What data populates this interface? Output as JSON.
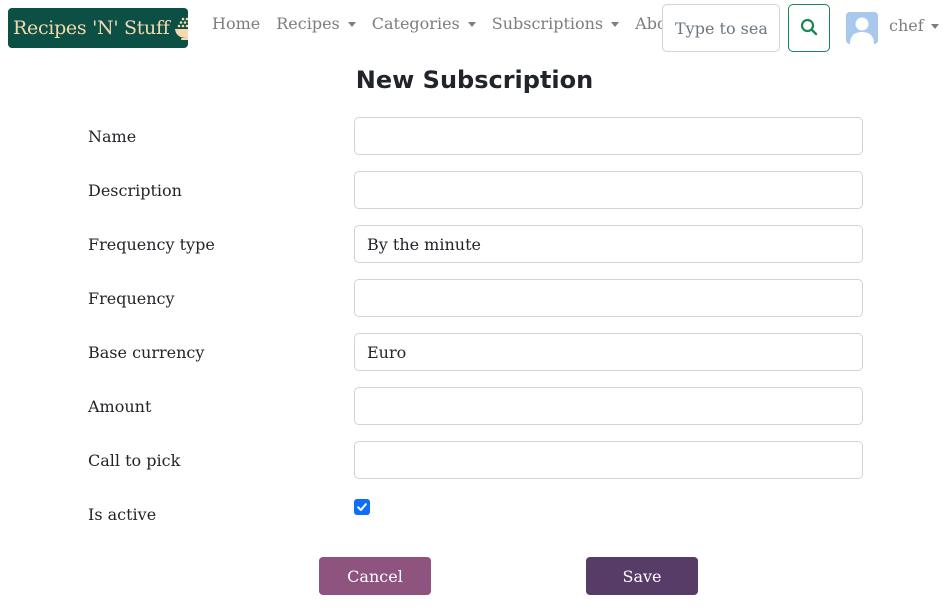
{
  "brand": {
    "name": "Recipes 'N' Stuff",
    "icon": "bowl-icon"
  },
  "nav": {
    "home": "Home",
    "recipes": "Recipes",
    "categories": "Categories",
    "subscriptions": "Subscriptions",
    "about": "About"
  },
  "search": {
    "placeholder": "Type to search",
    "button_icon": "search-icon"
  },
  "user": {
    "name": "chef",
    "avatar_icon": "user-avatar-icon"
  },
  "form": {
    "title": "New Subscription",
    "fields": [
      {
        "label": "Name",
        "value": ""
      },
      {
        "label": "Description",
        "value": ""
      },
      {
        "label": "Frequency type",
        "value": "By the minute"
      },
      {
        "label": "Frequency",
        "value": ""
      },
      {
        "label": "Base currency",
        "value": "Euro"
      },
      {
        "label": "Amount",
        "value": ""
      },
      {
        "label": "Call to pick",
        "value": ""
      }
    ],
    "is_active": {
      "label": "Is active",
      "checked": true
    },
    "cancel_label": "Cancel",
    "save_label": "Save"
  },
  "colors": {
    "brand_bg": "#0c4f45",
    "brand_text": "#f4d9b0",
    "search_accent": "#198754",
    "checkbox": "#0d6efd",
    "cancel_bg": "#8e537e",
    "save_bg": "#583c68"
  }
}
